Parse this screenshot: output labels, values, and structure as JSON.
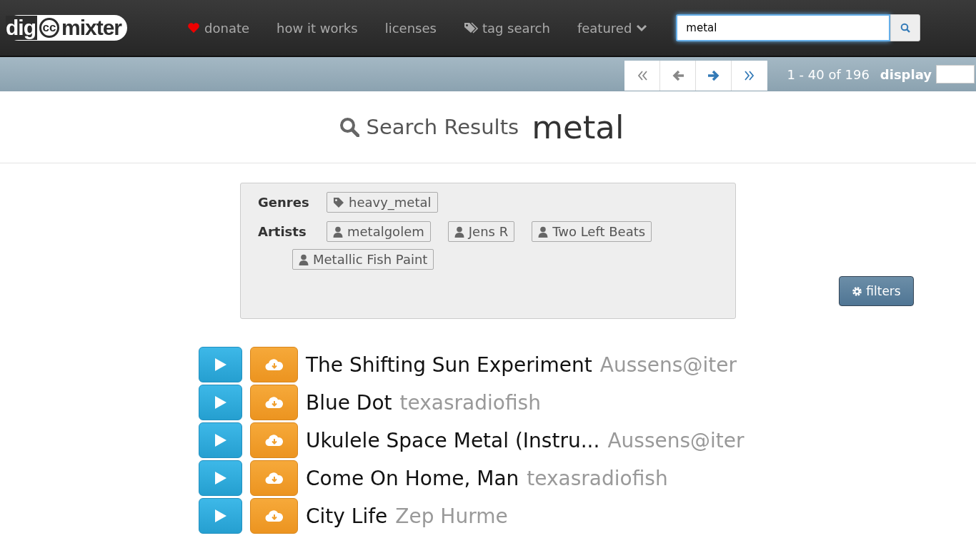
{
  "logo": {
    "parts": [
      "dig",
      "cc",
      "mixter"
    ]
  },
  "nav": [
    {
      "label": "donate",
      "kind": "heart"
    },
    {
      "label": "how it works",
      "kind": "plain"
    },
    {
      "label": "licenses",
      "kind": "plain"
    },
    {
      "label": "tag search",
      "kind": "tag"
    },
    {
      "label": "featured",
      "kind": "dropdown"
    }
  ],
  "search": {
    "value": "metal"
  },
  "pager": {
    "buttons": [
      {
        "kind": "first",
        "disabled": true
      },
      {
        "kind": "prev",
        "disabled": true
      },
      {
        "kind": "next",
        "disabled": false
      },
      {
        "kind": "last",
        "disabled": false
      }
    ],
    "range": "1 - 40 of 196",
    "display_label": "display"
  },
  "heading": {
    "label": "Search Results",
    "query": "metal"
  },
  "filters_box": {
    "groups": [
      {
        "label": "Genres",
        "kind": "tag",
        "items": [
          "heavy_metal"
        ]
      },
      {
        "label": "Artists",
        "kind": "user",
        "items": [
          "metalgolem",
          "Jens R",
          "Two Left Beats",
          "Metallic Fish Paint"
        ]
      }
    ]
  },
  "filters_button": "filters",
  "tracks": [
    {
      "title": "The Shifting Sun Experiment",
      "artist": "Aussens@iter"
    },
    {
      "title": "Blue Dot",
      "artist": "texasradiofish"
    },
    {
      "title": "Ukulele Space Metal (Instru...",
      "artist": "Aussens@iter"
    },
    {
      "title": "Come On Home, Man",
      "artist": "texasradiofish"
    },
    {
      "title": "City Life",
      "artist": "Zep Hurme"
    }
  ]
}
